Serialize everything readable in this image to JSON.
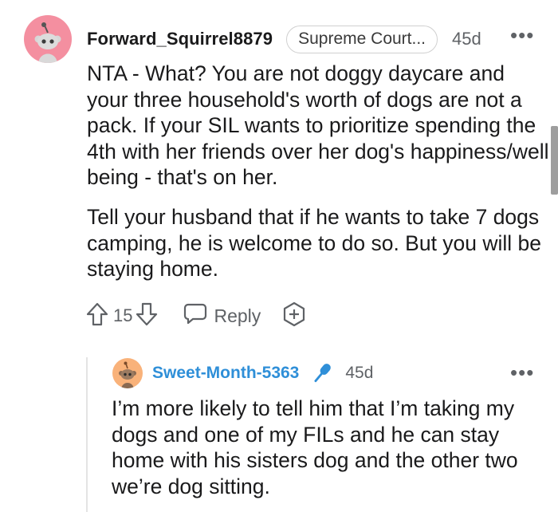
{
  "comment": {
    "username": "Forward_Squirrel8879",
    "flair": "Supreme Court...",
    "age": "45d",
    "more_icon": "more-dots-icon",
    "avatar_color": "#f48fa0",
    "paragraphs": [
      "NTA - What? You are not doggy daycare and your three household's worth of dogs are not a pack. If your SIL wants to prioritize spending the 4th with her friends over her dog's happiness/well being - that's on her.",
      "Tell your husband that if he wants to take 7 dogs camping, he is welcome to do so. But you will be staying home."
    ],
    "actions": {
      "upvote_icon": "upvote-arrow-icon",
      "vote_count": "15",
      "downvote_icon": "downvote-arrow-icon",
      "reply_icon": "speech-bubble-icon",
      "reply_label": "Reply",
      "award_icon": "award-plus-icon"
    }
  },
  "reply": {
    "username": "Sweet-Month-5363",
    "username_color": "#2f8fd8",
    "badge_icon": "microphone-icon",
    "age": "45d",
    "more_icon": "more-dots-icon",
    "avatar_color": "#f9b27a",
    "text": "I’m more likely to tell him that I’m taking my dogs and one of my FILs and he can stay home with his sisters dog and the other two we’re dog sitting."
  }
}
